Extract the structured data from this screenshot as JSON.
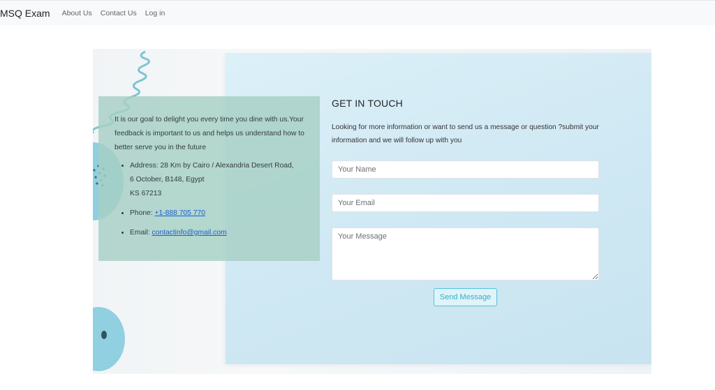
{
  "navbar": {
    "brand": "MSQ Exam",
    "links": [
      "About Us",
      "Contact Us",
      "Log in"
    ]
  },
  "info": {
    "intro": "It is our goal to delight you every time you dine with us.Your feedback is important to us and helps us understand how to better serve you in the future",
    "address_label": "Address: ",
    "address_line1": "28 Km by Cairo / Alexandria Desert Road,",
    "address_line2": "6 October, B148, Egypt",
    "address_line3": "KS 67213",
    "phone_label": "Phone: ",
    "phone": "+1-888 705 770",
    "email_label": "Email: ",
    "email": "contactinfo@gmail.com"
  },
  "form": {
    "title": "GET IN TOUCH",
    "description": "Looking for more information or want to send us a message or question ?submit your information and we will follow up with you",
    "name_placeholder": "Your Name",
    "email_placeholder": "Your Email",
    "message_placeholder": "Your Message",
    "submit_label": "Send Message"
  },
  "colors": {
    "info_box": "#a6d0c4",
    "panel": "#cfe8f3",
    "button_border": "#53c2dc",
    "link": "#1a5fd0"
  }
}
